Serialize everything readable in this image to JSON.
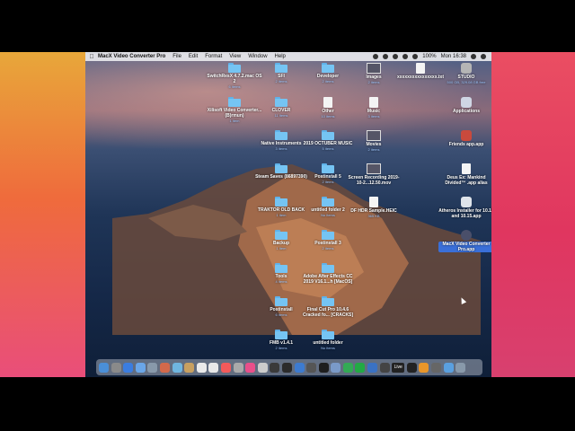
{
  "menubar": {
    "app_name": "MacX Video Converter Pro",
    "menus": [
      "File",
      "Edit",
      "Format",
      "View",
      "Window",
      "Help"
    ],
    "battery": "100%",
    "clock": "Mon 16:38"
  },
  "desktop": {
    "col1": [
      {
        "name": "SwitchResX 4.7.2.mac OS 2",
        "sub": "6 items",
        "icon": "folder"
      },
      {
        "name": "Xilisoft Video Converter... (B)rmun)",
        "sub": "1 item",
        "icon": "folder"
      }
    ],
    "col2": [
      {
        "name": "SFI",
        "sub": "2 items",
        "icon": "folder"
      },
      {
        "name": "CLOVER",
        "sub": "11 items",
        "icon": "folder"
      },
      {
        "name": "Native Instruments",
        "sub": "3 items",
        "icon": "folder"
      },
      {
        "name": "Steam Saves (86897390)",
        "sub": "",
        "icon": "folder"
      },
      {
        "name": "TRAKTOR OLD BACK",
        "sub": "1 item",
        "icon": "folder"
      },
      {
        "name": "Backup",
        "sub": "1 item",
        "icon": "folder"
      },
      {
        "name": "Tools",
        "sub": "4 items",
        "icon": "folder"
      },
      {
        "name": "Postinstall",
        "sub": "6 items",
        "icon": "folder"
      },
      {
        "name": "FMB v1.4.1",
        "sub": "2 items",
        "icon": "folder"
      }
    ],
    "col3": [
      {
        "name": "Developer",
        "sub": "2 items",
        "icon": "folder"
      },
      {
        "name": "Other",
        "sub": "10 items",
        "icon": "doc"
      },
      {
        "name": "2019 OCTUBER MUSIC",
        "sub": "5 items",
        "icon": "folder"
      },
      {
        "name": "Postinstall 5",
        "sub": "2 items",
        "icon": "folder"
      },
      {
        "name": "untitled folder 2",
        "sub": "No items",
        "icon": "folder"
      },
      {
        "name": "Postinstall 3",
        "sub": "2 items",
        "icon": "folder"
      },
      {
        "name": "Adobe After Effects CC 2019 V16.1...h [MacOS]",
        "sub": "",
        "icon": "folder"
      },
      {
        "name": "Final Cut Pro 10.4.6 Cracked fo... [CRACKS]",
        "sub": "",
        "icon": "folder"
      },
      {
        "name": "untitled folder",
        "sub": "No items",
        "icon": "folder"
      }
    ],
    "col4": [
      {
        "name": "Images",
        "sub": "2 items",
        "icon": "thumb"
      },
      {
        "name": "Music",
        "sub": "3 items",
        "icon": "doc"
      },
      {
        "name": "Movies",
        "sub": "2 items",
        "icon": "thumb"
      },
      {
        "name": "Screen Recording 2019-10-2...12.50.mov",
        "sub": "",
        "icon": "thumb"
      },
      {
        "name": "DF HDR Sample.HEIC",
        "sub": "365 KB",
        "icon": "doc"
      }
    ],
    "col5": [
      {
        "name": "xxxxxxxxxxxxxxxx.txt",
        "sub": "",
        "icon": "doc"
      }
    ],
    "col6": [
      {
        "name": "STUDIO",
        "sub": "500 GB, 329.08 GB free",
        "icon": "drive"
      },
      {
        "name": "Applications",
        "sub": "",
        "icon": "app"
      },
      {
        "name": "Friends app.app",
        "sub": "",
        "icon": "app"
      },
      {
        "name": "Deus Ex: Mankind Divided™ .app alias",
        "sub": "",
        "icon": "app"
      },
      {
        "name": "Atheros Installer for 10.14 and 10.15.app",
        "sub": "",
        "icon": "app"
      },
      {
        "name": "MacX Video Converter Pro.app",
        "sub": "",
        "icon": "app"
      }
    ]
  },
  "dock": {
    "live_label": "Live",
    "colors": [
      "#4a8fd8",
      "#8a8a8a",
      "#3b7de0",
      "#6aa6e8",
      "#8899aa",
      "#d2694b",
      "#6fb6e0",
      "#c8a060",
      "#eaeaea",
      "#e8e8e8",
      "#f25a5a",
      "#aaaaaa",
      "#e94f8a",
      "#cccccc",
      "#3a3a3a",
      "#2b2b2b",
      "#3d7bd0",
      "#555555",
      "#1e1e1e",
      "#7a9ac8",
      "#33aa55",
      "#22aa44",
      "#3a72c4",
      "#444444",
      "#222222",
      "#e8962a",
      "#666666",
      "#5aa0e0",
      "#8899aa"
    ]
  }
}
